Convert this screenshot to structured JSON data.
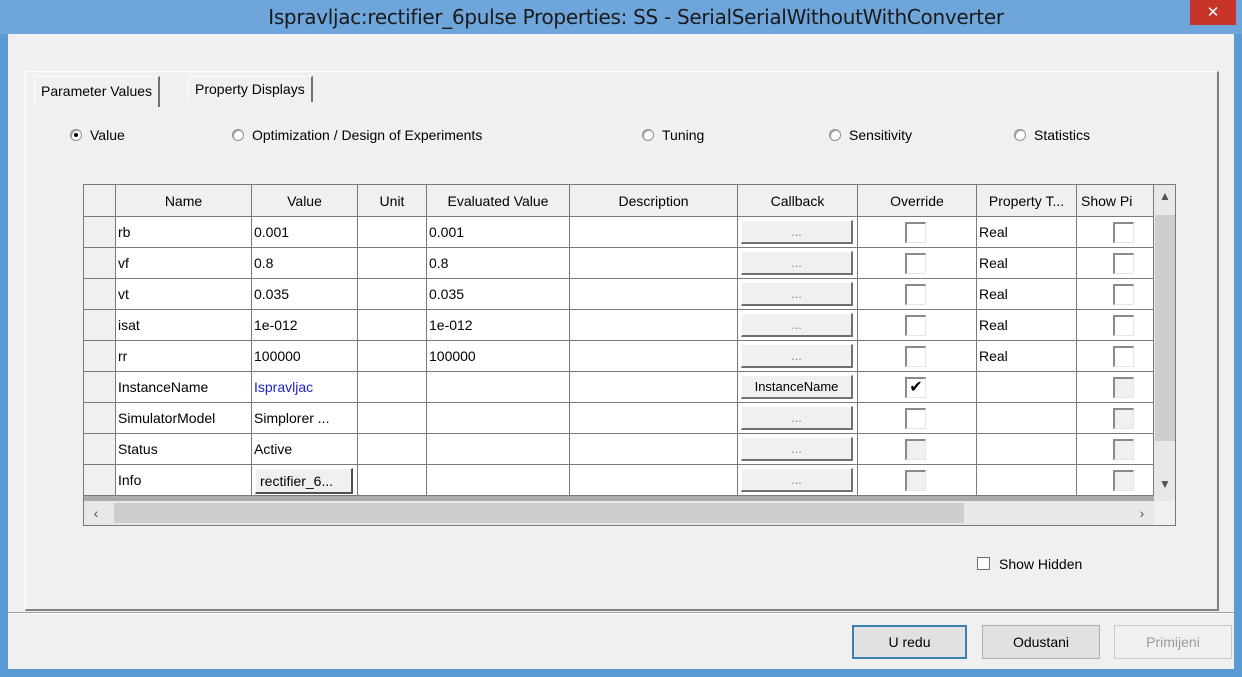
{
  "window": {
    "title": "Ispravljac:rectifier_6pulse Properties: SS - SerialSerialWithoutWithConverter",
    "close_glyph": "✕"
  },
  "tabs": [
    {
      "label": "Parameter Values",
      "active": true
    },
    {
      "label": "Property Displays",
      "active": false
    }
  ],
  "modes": [
    {
      "label": "Value",
      "selected": true
    },
    {
      "label": "Optimization / Design of Experiments",
      "selected": false
    },
    {
      "label": "Tuning",
      "selected": false
    },
    {
      "label": "Sensitivity",
      "selected": false
    },
    {
      "label": "Statistics",
      "selected": false
    }
  ],
  "table": {
    "columns": [
      "Name",
      "Value",
      "Unit",
      "Evaluated Value",
      "Description",
      "Callback",
      "Override",
      "Property T...",
      "Show Pi"
    ],
    "rows": [
      {
        "name": "rb",
        "value": "0.001",
        "unit": "",
        "evaluated": "0.001",
        "description": "",
        "callback": "...",
        "override": false,
        "type": "Real",
        "show": false
      },
      {
        "name": "vf",
        "value": "0.8",
        "unit": "",
        "evaluated": "0.8",
        "description": "",
        "callback": "...",
        "override": false,
        "type": "Real",
        "show": false
      },
      {
        "name": "vt",
        "value": "0.035",
        "unit": "",
        "evaluated": "0.035",
        "description": "",
        "callback": "...",
        "override": false,
        "type": "Real",
        "show": false
      },
      {
        "name": "isat",
        "value": "1e-012",
        "unit": "",
        "evaluated": "1e-012",
        "description": "",
        "callback": "...",
        "override": false,
        "type": "Real",
        "show": false
      },
      {
        "name": "rr",
        "value": "100000",
        "unit": "",
        "evaluated": "100000",
        "description": "",
        "callback": "...",
        "override": false,
        "type": "Real",
        "show": false
      },
      {
        "name": "InstanceName",
        "value": "Ispravljac",
        "unit": "",
        "evaluated": "",
        "description": "",
        "callback": "InstanceName",
        "override": true,
        "type": "",
        "show": false
      },
      {
        "name": "SimulatorModel",
        "value": "Simplorer ...",
        "unit": "",
        "evaluated": "",
        "description": "",
        "callback": "...",
        "override": false,
        "type": "",
        "show": false
      },
      {
        "name": "Status",
        "value": "Active",
        "unit": "",
        "evaluated": "",
        "description": "",
        "callback": "...",
        "override": false,
        "type": "",
        "show": false
      },
      {
        "name": "Info",
        "value": "rectifier_6...",
        "unit": "",
        "evaluated": "",
        "description": "",
        "callback": "...",
        "override": false,
        "type": "",
        "show": false
      }
    ]
  },
  "show_hidden": {
    "label": "Show Hidden",
    "checked": false
  },
  "buttons": {
    "ok": "U redu",
    "cancel": "Odustani",
    "apply": "Primijeni"
  },
  "icons": {
    "scroll_up": "chevron-up-icon",
    "scroll_down": "chevron-down-icon",
    "scroll_left": "chevron-left-icon",
    "scroll_right": "chevron-right-icon"
  },
  "colors": {
    "titlebar": "#6ea6dc",
    "close": "#c7352a",
    "link_value": "#2020d0",
    "default_button_border": "#3c7fb1"
  }
}
